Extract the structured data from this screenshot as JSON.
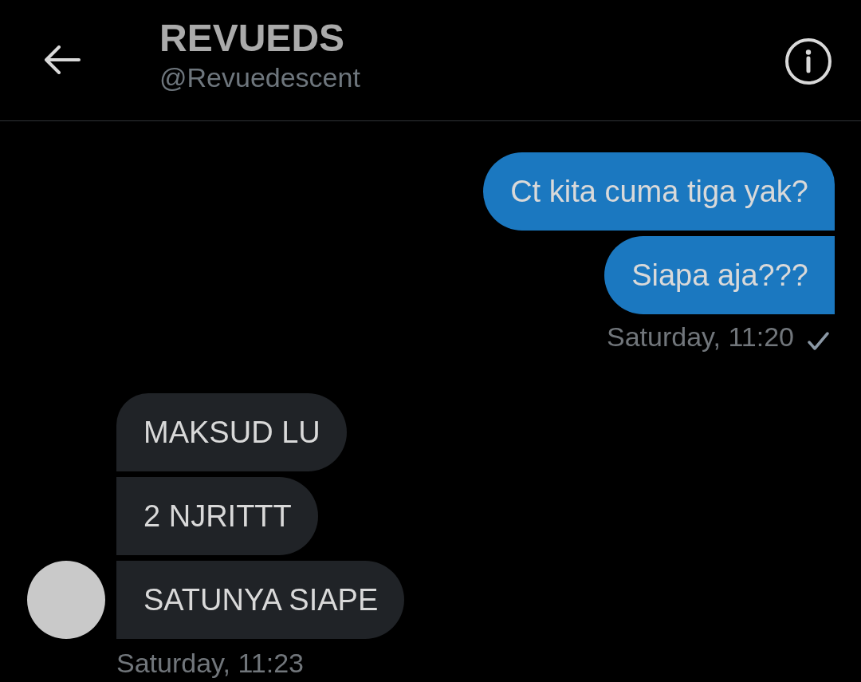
{
  "header": {
    "title": "REVUEDS",
    "handle": "@Revuedescent"
  },
  "message_groups": [
    {
      "kind": "outgoing",
      "messages": [
        "Ct kita cuma tiga yak?",
        "Siapa aja???"
      ],
      "time": "Saturday, 11:20",
      "check_mark": true
    },
    {
      "kind": "incoming",
      "messages": [
        "MAKSUD LU",
        "2 NJRITTT",
        "SATUNYA SIAPE"
      ],
      "time": "Saturday, 11:23",
      "check_mark": false
    }
  ]
}
